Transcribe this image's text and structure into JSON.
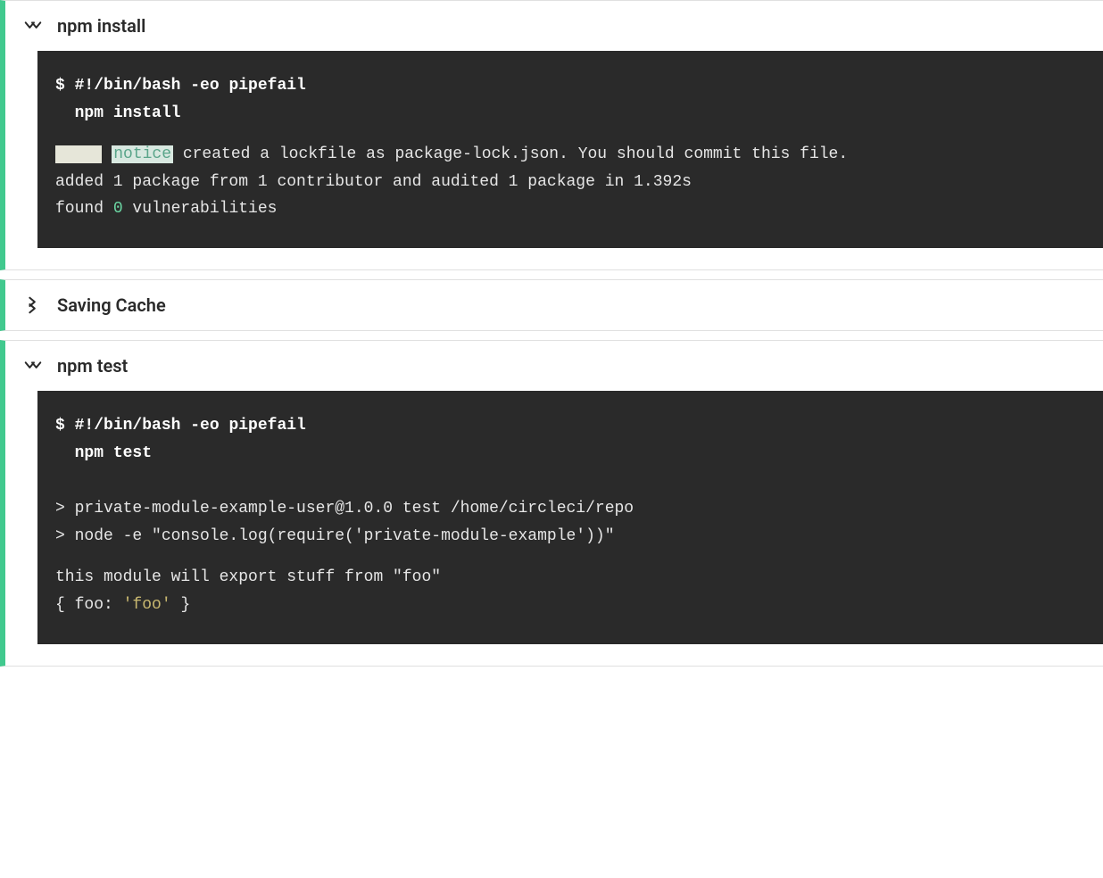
{
  "steps": [
    {
      "title": "npm install",
      "expanded": true,
      "command_prefix": "$ ",
      "shebang": "#!/bin/bash -eo pipefail",
      "command_indent": "  ",
      "command": "npm install",
      "output": {
        "notice_blank": "   ",
        "notice_label": "notice",
        "notice_text": " created a lockfile as package-lock.json. You should commit this file.",
        "line2": "added 1 package from 1 contributor and audited 1 package in 1.392s",
        "line3_a": "found ",
        "line3_num": "0",
        "line3_b": " vulnerabilities"
      }
    },
    {
      "title": "Saving Cache",
      "expanded": false
    },
    {
      "title": "npm test",
      "expanded": true,
      "command_prefix": "$ ",
      "shebang": "#!/bin/bash -eo pipefail",
      "command_indent": "  ",
      "command": "npm test",
      "output": {
        "line1": "> private-module-example-user@1.0.0 test /home/circleci/repo",
        "line2": "> node -e \"console.log(require('private-module-example'))\"",
        "line3": "this module will export stuff from \"foo\"",
        "line4_a": "{ foo: ",
        "line4_str": "'foo'",
        "line4_b": " }"
      }
    }
  ]
}
